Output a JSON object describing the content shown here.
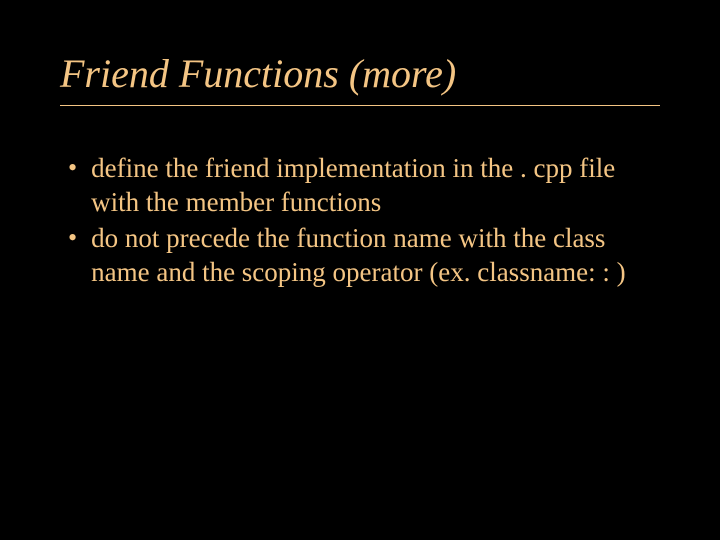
{
  "slide": {
    "title": "Friend Functions (more)",
    "bullets": [
      {
        "marker": "•",
        "text": "define the friend implementation in the . cpp file with the member functions"
      },
      {
        "marker": "•",
        "text": "do not precede the function name with the class name and the scoping operator (ex. classname: : )"
      }
    ]
  }
}
